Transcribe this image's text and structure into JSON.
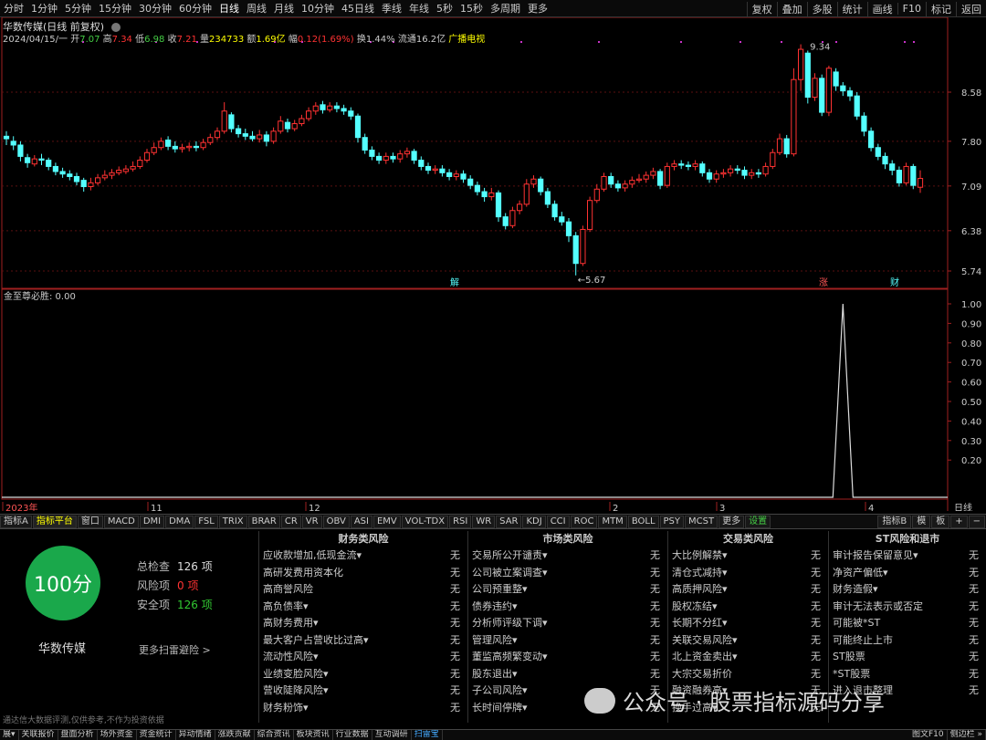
{
  "toolbar": {
    "periods": [
      "分时",
      "1分钟",
      "5分钟",
      "15分钟",
      "30分钟",
      "60分钟",
      "日线",
      "周线",
      "月线",
      "10分钟",
      "45日线",
      "季线",
      "年线",
      "5秒",
      "15秒",
      "多周期",
      "更多"
    ],
    "active_period": "日线",
    "right": [
      "复权",
      "叠加",
      "多股",
      "统计",
      "画线",
      "F10",
      "标记",
      "返回"
    ]
  },
  "stock": {
    "title": "华数传媒(日线 前复权)",
    "date": "2024/04/15/一",
    "open_label": "开",
    "open": "7.07",
    "high_label": "高",
    "high": "7.34",
    "low_label": "低",
    "low": "6.98",
    "close_label": "收",
    "close": "7.21",
    "vol_label": "量",
    "vol": "234733",
    "amount_label": "额",
    "amount": "1.69亿",
    "pct_label": "幅",
    "pct": "0.12(1.69%)",
    "turnover_label": "换",
    "turnover": "1.44%",
    "float_label": "流通",
    "float": "16.2亿",
    "sector": "广播电视"
  },
  "price_axis": [
    "8.58",
    "7.80",
    "7.09",
    "6.38",
    "5.74"
  ],
  "price_marks": {
    "high": "9.34",
    "low": "←5.67"
  },
  "event_markers": [
    "解",
    "涨",
    "财"
  ],
  "indicator": {
    "name": "金至尊必胜",
    "label": "金至尊必胜: 0.00",
    "axis": [
      "1.00",
      "0.90",
      "0.80",
      "0.70",
      "0.60",
      "0.50",
      "0.40",
      "0.30",
      "0.20"
    ]
  },
  "time_axis": {
    "labels": [
      "2023年",
      "11",
      "12",
      "2",
      "3",
      "4"
    ],
    "period": "日线"
  },
  "indicator_tabs": [
    "指标A",
    "指标平台",
    "窗口",
    "MACD",
    "DMI",
    "DMA",
    "FSL",
    "TRIX",
    "BRAR",
    "CR",
    "VR",
    "OBV",
    "ASI",
    "EMV",
    "VOL-TDX",
    "RSI",
    "WR",
    "SAR",
    "KDJ",
    "CCI",
    "ROC",
    "MTM",
    "BOLL",
    "PSY",
    "MCST",
    "更多",
    "设置"
  ],
  "indicator_tabs_right": [
    "指标B",
    "模",
    "板",
    "+",
    "−"
  ],
  "scan": {
    "score": "100分",
    "stock_name": "华数传媒",
    "total_label": "总检查",
    "total": "126 项",
    "risk_label": "风险项",
    "risk": "0 项",
    "safe_label": "安全项",
    "safe": "126 项",
    "more_link": "更多扫雷避险 >",
    "disclaimer": "通达信大数据评测,仅供参考,不作为投资依据",
    "columns": [
      {
        "title": "财务类风险",
        "items": [
          {
            "name": "应收款增加,低现金流▾",
            "status": "无"
          },
          {
            "name": "高研发费用资本化",
            "status": "无"
          },
          {
            "name": "高商誉风险",
            "status": "无"
          },
          {
            "name": "高负债率▾",
            "status": "无"
          },
          {
            "name": "高财务费用▾",
            "status": "无"
          },
          {
            "name": "最大客户占营收比过高▾",
            "status": "无"
          },
          {
            "name": "流动性风险▾",
            "status": "无"
          },
          {
            "name": "业绩变脸风险▾",
            "status": "无"
          },
          {
            "name": "营收陡降风险▾",
            "status": "无"
          },
          {
            "name": "财务粉饰▾",
            "status": "无"
          }
        ]
      },
      {
        "title": "市场类风险",
        "items": [
          {
            "name": "交易所公开谴责▾",
            "status": "无"
          },
          {
            "name": "公司被立案调查▾",
            "status": "无"
          },
          {
            "name": "公司预重整▾",
            "status": "无"
          },
          {
            "name": "债券违约▾",
            "status": "无"
          },
          {
            "name": "分析师评级下调▾",
            "status": "无"
          },
          {
            "name": "管理风险▾",
            "status": "无"
          },
          {
            "name": "董监高频繁变动▾",
            "status": "无"
          },
          {
            "name": "股东退出▾",
            "status": "无"
          },
          {
            "name": "子公司风险▾",
            "status": "无"
          },
          {
            "name": "长时间停牌▾",
            "status": "无"
          }
        ]
      },
      {
        "title": "交易类风险",
        "items": [
          {
            "name": "大比例解禁▾",
            "status": "无"
          },
          {
            "name": "清仓式减持▾",
            "status": "无"
          },
          {
            "name": "高质押风险▾",
            "status": "无"
          },
          {
            "name": "股权冻结▾",
            "status": "无"
          },
          {
            "name": "长期不分红▾",
            "status": "无"
          },
          {
            "name": "关联交易风险▾",
            "status": "无"
          },
          {
            "name": "北上资金卖出▾",
            "status": "无"
          },
          {
            "name": "大宗交易折价",
            "status": "无"
          },
          {
            "name": "融资融券高▾",
            "status": "无"
          },
          {
            "name": "换手过高▾",
            "status": "无"
          }
        ]
      },
      {
        "title": "ST风险和退市",
        "items": [
          {
            "name": "审计报告保留意见▾",
            "status": "无"
          },
          {
            "name": "净资产偏低▾",
            "status": "无"
          },
          {
            "name": "财务造假▾",
            "status": "无"
          },
          {
            "name": "审计无法表示或否定",
            "status": "无"
          },
          {
            "name": "可能被*ST",
            "status": "无"
          },
          {
            "name": "可能终止上市",
            "status": "无"
          },
          {
            "name": "ST股票",
            "status": "无"
          },
          {
            "name": "*ST股票",
            "status": "无"
          },
          {
            "name": "进入退市整理",
            "status": "无"
          },
          {
            "name": "",
            "status": ""
          }
        ]
      }
    ]
  },
  "bottom_tabs": [
    "展▾",
    "关联报价",
    "盘面分析",
    "场外资金",
    "资金统计",
    "异动情绪",
    "涨跌贡献",
    "综合资讯",
    "板块资讯",
    "行业数据",
    "互动调研",
    "扫雷宝"
  ],
  "bottom_tabs_right": [
    "图文F10",
    "侧边栏 »"
  ],
  "watermark": "公众号 · 股票指标源码分享",
  "colors": {
    "up": "#ff3232",
    "down": "#54ffff",
    "ma_dot": "#c832c8",
    "score": "#1aa84b",
    "risk": "#ff3232",
    "safe": "#32c832"
  },
  "chart_data": {
    "type": "candlestick",
    "price_ticks": [
      8.58,
      7.8,
      7.09,
      6.38,
      5.74
    ],
    "candles": [
      [
        7.88,
        7.84,
        7.96,
        7.74
      ],
      [
        7.8,
        7.74,
        7.88,
        7.66
      ],
      [
        7.74,
        7.56,
        7.8,
        7.48
      ],
      [
        7.54,
        7.46,
        7.6,
        7.38
      ],
      [
        7.44,
        7.52,
        7.58,
        7.4
      ],
      [
        7.52,
        7.5,
        7.6,
        7.42
      ],
      [
        7.5,
        7.4,
        7.54,
        7.34
      ],
      [
        7.4,
        7.32,
        7.46,
        7.26
      ],
      [
        7.32,
        7.28,
        7.38,
        7.22
      ],
      [
        7.28,
        7.24,
        7.34,
        7.18
      ],
      [
        7.24,
        7.16,
        7.3,
        7.1
      ],
      [
        7.18,
        7.08,
        7.22,
        7.0
      ],
      [
        7.08,
        7.14,
        7.22,
        7.02
      ],
      [
        7.14,
        7.22,
        7.28,
        7.1
      ],
      [
        7.22,
        7.26,
        7.34,
        7.18
      ],
      [
        7.26,
        7.3,
        7.36,
        7.2
      ],
      [
        7.3,
        7.34,
        7.4,
        7.26
      ],
      [
        7.32,
        7.36,
        7.42,
        7.28
      ],
      [
        7.36,
        7.4,
        7.48,
        7.32
      ],
      [
        7.4,
        7.5,
        7.56,
        7.36
      ],
      [
        7.5,
        7.62,
        7.68,
        7.46
      ],
      [
        7.62,
        7.7,
        7.78,
        7.58
      ],
      [
        7.7,
        7.8,
        7.86,
        7.66
      ],
      [
        7.82,
        7.72,
        7.88,
        7.66
      ],
      [
        7.72,
        7.68,
        7.8,
        7.62
      ],
      [
        7.68,
        7.7,
        7.76,
        7.62
      ],
      [
        7.7,
        7.72,
        7.78,
        7.64
      ],
      [
        7.72,
        7.7,
        7.8,
        7.64
      ],
      [
        7.7,
        7.78,
        7.84,
        7.66
      ],
      [
        7.78,
        7.86,
        7.92,
        7.74
      ],
      [
        7.86,
        7.96,
        8.02,
        7.82
      ],
      [
        7.96,
        8.28,
        8.42,
        7.92
      ],
      [
        8.22,
        8.0,
        8.26,
        7.94
      ],
      [
        8.0,
        7.92,
        8.06,
        7.86
      ],
      [
        7.92,
        7.88,
        8.0,
        7.82
      ],
      [
        7.88,
        7.84,
        7.96,
        7.8
      ],
      [
        7.84,
        7.9,
        7.98,
        7.78
      ],
      [
        7.9,
        7.8,
        7.96,
        7.72
      ],
      [
        7.8,
        7.96,
        8.02,
        7.76
      ],
      [
        7.96,
        8.12,
        8.2,
        7.92
      ],
      [
        8.1,
        8.0,
        8.16,
        7.94
      ],
      [
        8.0,
        8.08,
        8.14,
        7.96
      ],
      [
        8.08,
        8.16,
        8.22,
        8.04
      ],
      [
        8.16,
        8.28,
        8.34,
        8.12
      ],
      [
        8.28,
        8.36,
        8.42,
        8.22
      ],
      [
        8.38,
        8.3,
        8.44,
        8.24
      ],
      [
        8.3,
        8.36,
        8.42,
        8.26
      ],
      [
        8.36,
        8.32,
        8.42,
        8.26
      ],
      [
        8.32,
        8.28,
        8.38,
        8.22
      ],
      [
        8.28,
        8.2,
        8.34,
        8.14
      ],
      [
        8.2,
        7.86,
        8.24,
        7.78
      ],
      [
        7.86,
        7.66,
        7.92,
        7.6
      ],
      [
        7.66,
        7.56,
        7.72,
        7.5
      ],
      [
        7.56,
        7.5,
        7.62,
        7.44
      ],
      [
        7.5,
        7.56,
        7.62,
        7.44
      ],
      [
        7.56,
        7.52,
        7.62,
        7.46
      ],
      [
        7.52,
        7.6,
        7.66,
        7.46
      ],
      [
        7.6,
        7.64,
        7.7,
        7.54
      ],
      [
        7.64,
        7.5,
        7.68,
        7.44
      ],
      [
        7.5,
        7.4,
        7.56,
        7.34
      ],
      [
        7.4,
        7.34,
        7.46,
        7.28
      ],
      [
        7.34,
        7.36,
        7.42,
        7.28
      ],
      [
        7.36,
        7.3,
        7.42,
        7.24
      ],
      [
        7.3,
        7.24,
        7.36,
        7.18
      ],
      [
        7.24,
        7.28,
        7.34,
        7.18
      ],
      [
        7.28,
        7.2,
        7.34,
        7.14
      ],
      [
        7.2,
        7.1,
        7.26,
        7.04
      ],
      [
        7.1,
        7.0,
        7.16,
        6.94
      ],
      [
        7.0,
        6.92,
        7.06,
        6.84
      ],
      [
        6.92,
        6.98,
        7.06,
        6.86
      ],
      [
        6.98,
        6.6,
        7.02,
        6.52
      ],
      [
        6.6,
        6.46,
        6.66,
        6.4
      ],
      [
        6.46,
        6.7,
        6.76,
        6.42
      ],
      [
        6.7,
        6.8,
        6.86,
        6.64
      ],
      [
        6.8,
        7.12,
        7.2,
        6.76
      ],
      [
        7.12,
        7.2,
        7.26,
        7.06
      ],
      [
        7.2,
        7.0,
        7.24,
        6.94
      ],
      [
        7.0,
        6.8,
        7.06,
        6.74
      ],
      [
        6.8,
        6.6,
        6.86,
        6.54
      ],
      [
        6.6,
        6.52,
        6.68,
        6.46
      ],
      [
        6.52,
        6.3,
        6.58,
        6.2
      ],
      [
        6.3,
        5.86,
        6.36,
        5.67
      ],
      [
        5.86,
        6.4,
        6.46,
        5.82
      ],
      [
        6.4,
        6.86,
        6.92,
        6.36
      ],
      [
        6.86,
        7.04,
        7.12,
        6.82
      ],
      [
        7.04,
        7.24,
        7.3,
        7.0
      ],
      [
        7.24,
        7.12,
        7.3,
        7.06
      ],
      [
        7.12,
        7.06,
        7.18,
        7.0
      ],
      [
        7.06,
        7.12,
        7.18,
        7.0
      ],
      [
        7.12,
        7.18,
        7.24,
        7.06
      ],
      [
        7.18,
        7.2,
        7.28,
        7.14
      ],
      [
        7.2,
        7.26,
        7.32,
        7.14
      ],
      [
        7.26,
        7.32,
        7.38,
        7.2
      ],
      [
        7.32,
        7.1,
        7.36,
        7.04
      ],
      [
        7.1,
        7.4,
        7.46,
        7.06
      ],
      [
        7.4,
        7.44,
        7.5,
        7.34
      ],
      [
        7.44,
        7.42,
        7.5,
        7.36
      ],
      [
        7.42,
        7.4,
        7.48,
        7.34
      ],
      [
        7.4,
        7.44,
        7.5,
        7.34
      ],
      [
        7.44,
        7.3,
        7.48,
        7.24
      ],
      [
        7.3,
        7.2,
        7.36,
        7.14
      ],
      [
        7.2,
        7.28,
        7.34,
        7.14
      ],
      [
        7.28,
        7.3,
        7.36,
        7.22
      ],
      [
        7.3,
        7.36,
        7.42,
        7.24
      ],
      [
        7.36,
        7.34,
        7.42,
        7.28
      ],
      [
        7.34,
        7.26,
        7.4,
        7.2
      ],
      [
        7.26,
        7.3,
        7.36,
        7.2
      ],
      [
        7.3,
        7.28,
        7.36,
        7.22
      ],
      [
        7.28,
        7.4,
        7.46,
        7.24
      ],
      [
        7.4,
        7.62,
        7.68,
        7.36
      ],
      [
        7.62,
        7.84,
        7.92,
        7.58
      ],
      [
        7.84,
        7.6,
        7.9,
        7.54
      ],
      [
        7.6,
        8.78,
        8.96,
        7.56
      ],
      [
        8.78,
        9.26,
        9.34,
        8.6
      ],
      [
        9.2,
        8.5,
        9.24,
        8.4
      ],
      [
        8.5,
        8.8,
        8.88,
        8.44
      ],
      [
        8.8,
        8.26,
        8.86,
        8.2
      ],
      [
        8.26,
        8.96,
        9.0,
        8.2
      ],
      [
        8.9,
        8.68,
        8.96,
        8.6
      ],
      [
        8.68,
        8.6,
        8.74,
        8.52
      ],
      [
        8.6,
        8.52,
        8.66,
        8.44
      ],
      [
        8.52,
        8.2,
        8.58,
        8.14
      ],
      [
        8.2,
        7.96,
        8.26,
        7.88
      ],
      [
        7.96,
        7.7,
        8.02,
        7.64
      ],
      [
        7.7,
        7.56,
        7.76,
        7.5
      ],
      [
        7.56,
        7.44,
        7.62,
        7.36
      ],
      [
        7.44,
        7.34,
        7.5,
        7.26
      ],
      [
        7.34,
        7.14,
        7.4,
        7.08
      ],
      [
        7.14,
        7.4,
        7.46,
        7.1
      ],
      [
        7.4,
        7.1,
        7.44,
        7.04
      ],
      [
        7.07,
        7.21,
        7.34,
        6.98
      ]
    ],
    "signal": {
      "values": [
        0,
        0,
        0,
        0,
        1,
        0,
        0
      ],
      "spike_at_candle": 119
    },
    "indicator_ticks": [
      1.0,
      0.9,
      0.8,
      0.7,
      0.6,
      0.5,
      0.4,
      0.3,
      0.2
    ]
  }
}
